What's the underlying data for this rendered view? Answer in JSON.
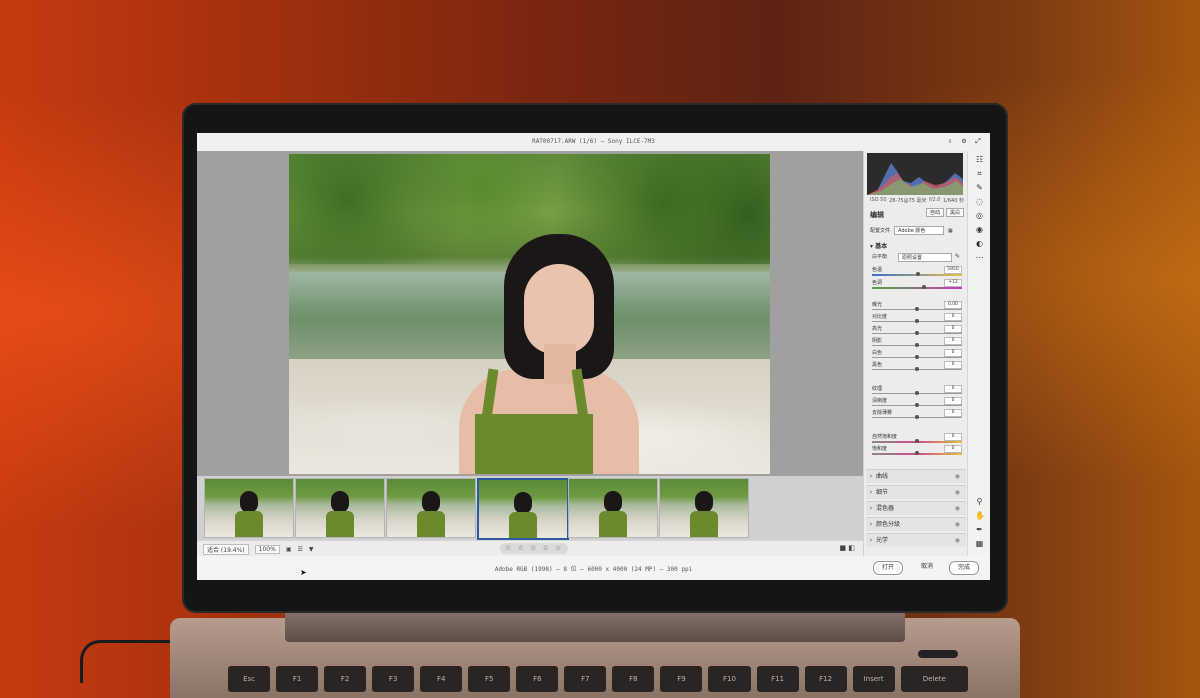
{
  "titlebar": {
    "title": "RAT00717.ARW (1/6) – Sony ILCE-7M3"
  },
  "filmstrip": {
    "count": 6,
    "selected_index": 3
  },
  "bottombar": {
    "filter_label": "适合 (19.4%)",
    "zoom_label": "100%",
    "rating_stars": "☆ ☆ ☆ ☆ ☆"
  },
  "infobar": {
    "file_info": "Adobe RGB (1998) – 8 位 – 6000 x 4000 (24 MP) – 300 ppi",
    "open_button": "打开",
    "cancel_button": "取消",
    "done_button": "完成"
  },
  "panel": {
    "meta": {
      "iso": "ISO 50",
      "lens": "28-75@75 毫米",
      "aperture": "f/2.0",
      "shutter": "1/640 秒"
    },
    "edit_title": "编辑",
    "edit_auto": "自动",
    "edit_bw": "黑白",
    "profile_label": "配置文件",
    "profile_value": "Adobe 颜色",
    "basic_title": "基本",
    "wb_label": "白平衡",
    "wb_value": "原照设置",
    "temp_label": "色温",
    "temp_value": "5950",
    "tint_label": "色调",
    "tint_value": "+12",
    "exposure_label": "曝光",
    "exposure_value": "0.00",
    "contrast_label": "对比度",
    "contrast_value": "0",
    "highlights_label": "高光",
    "highlights_value": "0",
    "shadows_label": "阴影",
    "shadows_value": "0",
    "whites_label": "白色",
    "whites_value": "0",
    "blacks_label": "黑色",
    "blacks_value": "0",
    "texture_label": "纹理",
    "texture_value": "0",
    "clarity_label": "清晰度",
    "clarity_value": "0",
    "dehaze_label": "去除薄雾",
    "dehaze_value": "0",
    "vibrance_label": "自然饱和度",
    "vibrance_value": "0",
    "saturation_label": "饱和度",
    "saturation_value": "0",
    "groups": [
      "曲线",
      "细节",
      "混色器",
      "颜色分级",
      "光学"
    ]
  },
  "colors": {
    "accent": "#2c5aa0",
    "panel_bg": "#ececec",
    "canvas_bg": "#a0a0a0"
  }
}
